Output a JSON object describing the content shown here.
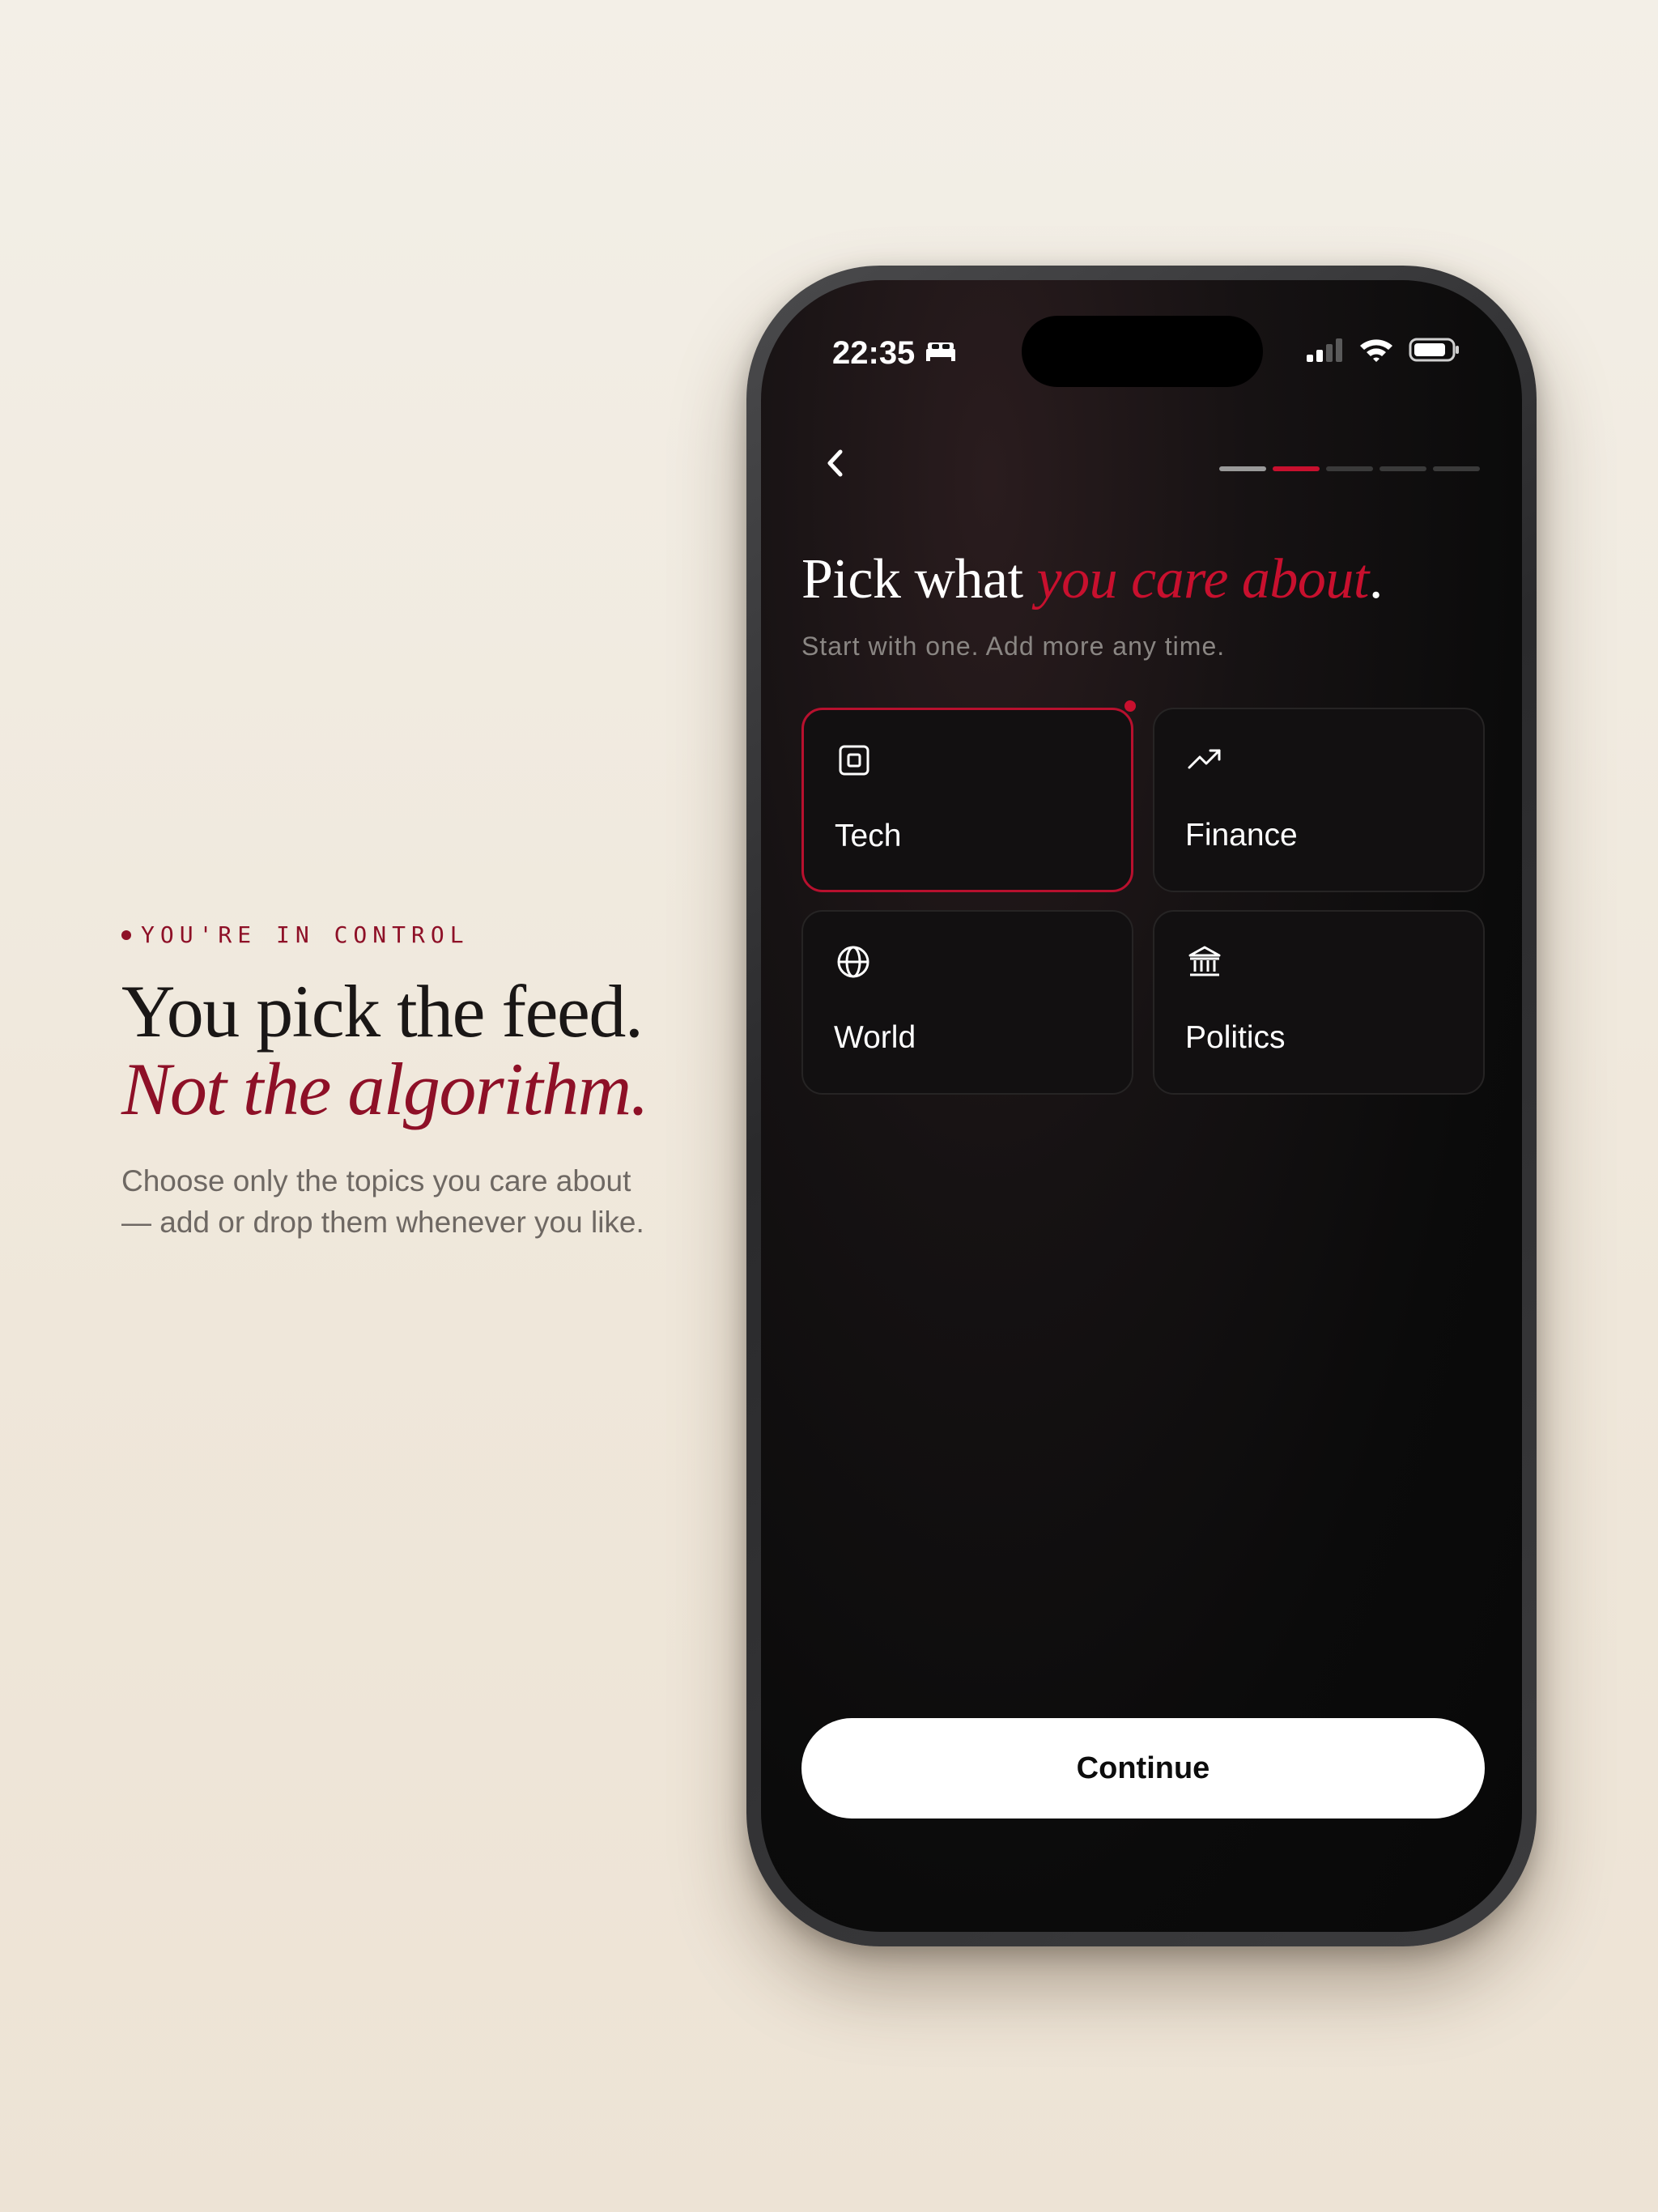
{
  "promo": {
    "eyebrow": "YOU'RE IN CONTROL",
    "headline_line1": "You pick the feed.",
    "headline_line2": "Not the algorithm.",
    "body": "Choose only the topics you care about — add or drop them whenever you like."
  },
  "status_bar": {
    "time": "22:35",
    "sleep_icon": "bed-icon",
    "signal_icon": "cellular-signal-icon",
    "wifi_icon": "wifi-icon",
    "battery_icon": "battery-icon"
  },
  "nav": {
    "back_icon": "chevron-left-icon",
    "progress": {
      "total_steps": 5,
      "current_step": 2
    }
  },
  "screen": {
    "title_plain": "Pick what",
    "title_accent": "you care about",
    "title_period": ".",
    "subtitle": "Start with one. Add more any time."
  },
  "topics": [
    {
      "label": "Tech",
      "icon": "chip-icon",
      "selected": true
    },
    {
      "label": "Finance",
      "icon": "trending-up-icon",
      "selected": false
    },
    {
      "label": "World",
      "icon": "globe-icon",
      "selected": false
    },
    {
      "label": "Politics",
      "icon": "bank-building-icon",
      "selected": false
    }
  ],
  "cta": {
    "continue_label": "Continue"
  },
  "colors": {
    "accent": "#8e1027",
    "accent_bright": "#c8102e",
    "background": "#f2ece3",
    "screen_bg": "#0b0b0b",
    "progress_done": "#9a9a9a",
    "progress_inactive": "#3a3a3a"
  }
}
